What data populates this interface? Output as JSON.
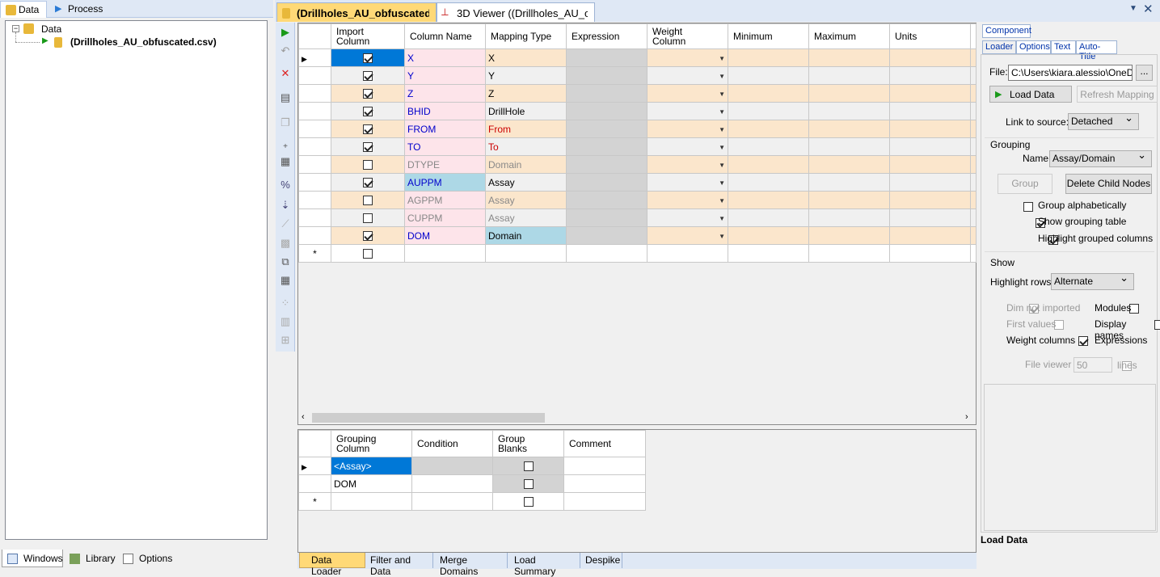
{
  "left_tabs": [
    "Data",
    "Process"
  ],
  "tree": {
    "root": "Data",
    "child": "(Drillholes_AU_obfuscated.csv)"
  },
  "left_bottom_tabs": [
    "Windows",
    "Library",
    "Options"
  ],
  "doc_tabs": [
    "(Drillholes_AU_obfuscated....",
    "3D Viewer ((Drillholes_AU_ob..."
  ],
  "grid": {
    "headers": [
      "Import\nColumn",
      "Column Name",
      "Mapping Type",
      "Expression",
      "Weight\nColumn",
      "Minimum",
      "Maximum",
      "Units"
    ],
    "rows": [
      {
        "import": true,
        "name": "X",
        "mapping": "X"
      },
      {
        "import": true,
        "name": "Y",
        "mapping": "Y"
      },
      {
        "import": true,
        "name": "Z",
        "mapping": "Z"
      },
      {
        "import": true,
        "name": "BHID",
        "mapping": "DrillHole"
      },
      {
        "import": true,
        "name": "FROM",
        "mapping": "From"
      },
      {
        "import": true,
        "name": "TO",
        "mapping": "To"
      },
      {
        "import": false,
        "name": "DTYPE",
        "mapping": "Domain"
      },
      {
        "import": true,
        "name": "AUPPM",
        "mapping": "Assay"
      },
      {
        "import": false,
        "name": "AGPPM",
        "mapping": "Assay"
      },
      {
        "import": false,
        "name": "CUPPM",
        "mapping": "Assay"
      },
      {
        "import": true,
        "name": "DOM",
        "mapping": "Domain"
      }
    ],
    "new_row_marker": "*"
  },
  "group_grid": {
    "headers": [
      "Grouping\nColumn",
      "Condition",
      "Group\nBlanks",
      "Comment"
    ],
    "rows": [
      {
        "column": "<Assay>",
        "condition": "",
        "blanks": false,
        "comment": ""
      },
      {
        "column": "DOM",
        "condition": "",
        "blanks": false,
        "comment": ""
      }
    ]
  },
  "bottom_tabs": [
    "Data Loader",
    "Filter and Data",
    "Merge Domains",
    "Load Summary",
    "Despike"
  ],
  "right": {
    "tab_component": "Component",
    "tabs": [
      "Loader",
      "Options",
      "Text",
      "Auto-Title"
    ],
    "file_label": "File:",
    "file_value": "C:\\Users\\kiara.alessio\\OneDrive",
    "browse": "...",
    "load_data": "Load Data",
    "refresh_mapping": "Refresh Mapping",
    "link_label": "Link to source:",
    "link_value": "Detached",
    "grouping_label": "Grouping",
    "name_label": "Name:",
    "name_value": "Assay/Domain",
    "group_btn": "Group",
    "delete_btn": "Delete Child Nodes",
    "group_alpha": "Group alphabetically",
    "show_grouping": "Show grouping table",
    "highlight_grouped": "Highlight grouped columns",
    "show_label": "Show",
    "highlight_rows_label": "Highlight rows:",
    "highlight_rows_value": "Alternate",
    "dim_not_imported": "Dim not imported",
    "modules": "Modules",
    "first_values": "First values",
    "display_names": "Display names",
    "weight_columns": "Weight columns",
    "expressions": "Expressions",
    "file_viewer": "File viewer",
    "file_viewer_lines": "50",
    "lines_label": "lines",
    "status": "Load Data"
  }
}
